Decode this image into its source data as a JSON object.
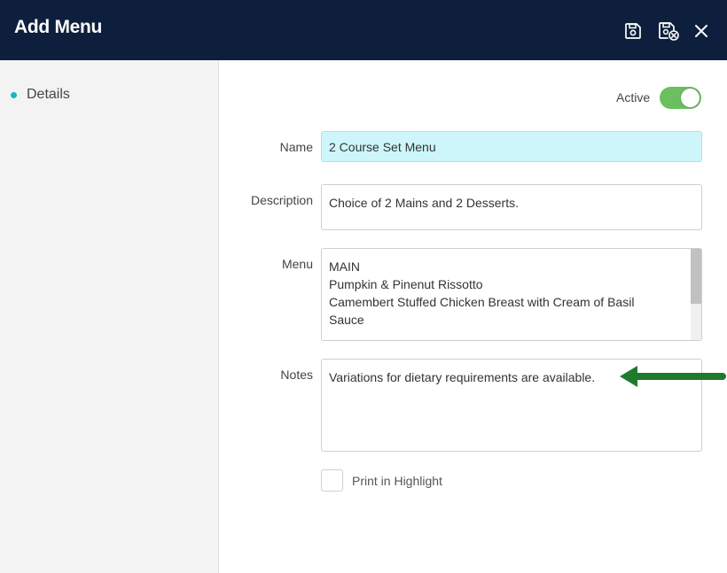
{
  "header": {
    "title": "Add Menu",
    "save_icon": "save-icon",
    "save_close_icon": "save-close-icon",
    "close_icon": "close-icon"
  },
  "sidebar": {
    "items": [
      {
        "label": "Details",
        "accent": "#19b6c7"
      }
    ]
  },
  "form": {
    "active_label": "Active",
    "active_on": true,
    "name": {
      "label": "Name",
      "value": "2 Course Set Menu"
    },
    "description": {
      "label": "Description",
      "value": "Choice of 2 Mains and 2 Desserts."
    },
    "menu": {
      "label": "Menu",
      "lines": [
        "MAIN",
        "Pumpkin & Pinenut Rissotto",
        "Camembert Stuffed Chicken Breast with Cream of Basil",
        "Sauce"
      ]
    },
    "notes": {
      "label": "Notes",
      "value": "Variations for dietary requirements are available."
    },
    "print_highlight": {
      "label": "Print in Highlight",
      "checked": false
    }
  },
  "colors": {
    "header_bg": "#0d1f3c",
    "toggle_on": "#6cbf5f",
    "name_highlight": "#cdf6fb",
    "annotation_arrow": "#1f7a2e"
  }
}
